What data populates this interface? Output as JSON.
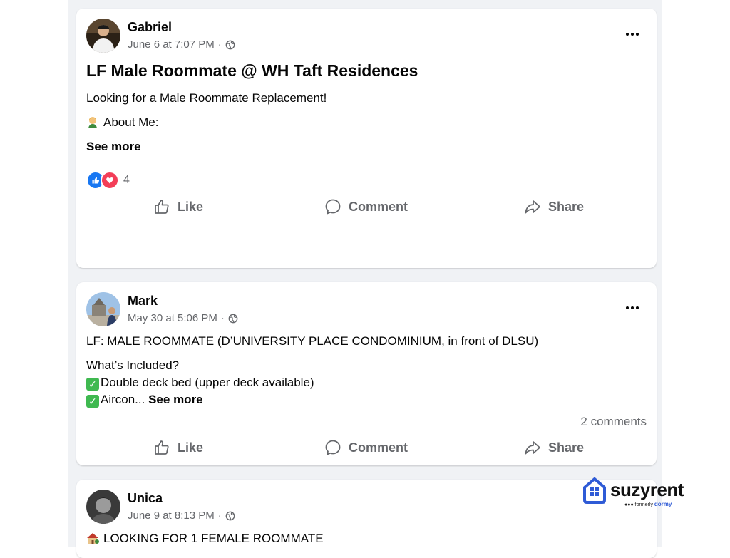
{
  "posts": [
    {
      "author": "Gabriel",
      "timestamp": "June 6 at 7:07 PM",
      "privacy_icon": "globe-icon",
      "title": "LF Male Roommate @ WH Taft Residences",
      "lines": [
        "Looking for a Male Roommate Replacement!",
        "About Me:"
      ],
      "about_emoji": "man-emoji",
      "see_more": "See more",
      "reaction_icons": [
        "like-icon",
        "love-icon"
      ],
      "reaction_count": "4",
      "actions": {
        "like": "Like",
        "comment": "Comment",
        "share": "Share"
      }
    },
    {
      "author": "Mark",
      "timestamp": "May 30 at 5:06 PM",
      "privacy_icon": "globe-icon",
      "lines": [
        "LF: MALE ROOMMATE (D’UNIVERSITY PLACE CONDOMINIUM, in front of DLSU)",
        "What’s Included?",
        "Double deck bed (upper deck available)",
        "Aircon..."
      ],
      "see_more": "See more",
      "comments_count": "2 comments",
      "actions": {
        "like": "Like",
        "comment": "Comment",
        "share": "Share"
      }
    },
    {
      "author": "Unica",
      "timestamp": "June 9 at 8:13 PM",
      "privacy_icon": "globe-icon",
      "lines": [
        "LOOKING FOR 1 FEMALE ROOMMATE"
      ]
    }
  ],
  "watermark": {
    "brand": "suzyrent",
    "formerly": "formerly",
    "old_brand": "dormy"
  },
  "colors": {
    "feed_bg": "#f0f2f5",
    "text_secondary": "#65676b",
    "like_blue": "#1877f2",
    "love_red": "#f33e58",
    "check_green": "#3fb950"
  }
}
